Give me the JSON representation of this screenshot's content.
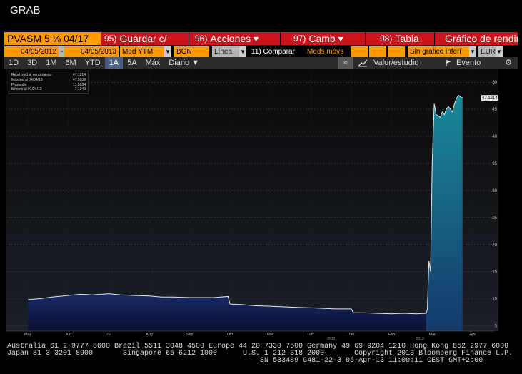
{
  "window": {
    "title": "GRAB"
  },
  "toolbar1": {
    "ticker": "PVASM 5 ⅛ 04/17",
    "buttons": [
      {
        "num": "95)",
        "label": "Guardar c/"
      },
      {
        "num": "96)",
        "label": "Acciones ▾"
      },
      {
        "num": "97)",
        "label": "Camb ▾"
      },
      {
        "num": "98)",
        "label": "Tabla"
      }
    ],
    "chart_title": "Gráfico de rendimiento"
  },
  "toolbar2": {
    "start_date": "04/05/2012",
    "dash": "-",
    "end_date": "04/05/2013",
    "field": "Med YTM",
    "source": "BGN",
    "chart_style": "Línea",
    "compare": "11) Comparar",
    "moving_avg": "Meds móvs",
    "event": "Sin gráfico inferi",
    "currency": "EUR"
  },
  "toolbar3": {
    "periods": [
      "1D",
      "3D",
      "1M",
      "6M",
      "YTD",
      "1A",
      "5A",
      "Máx"
    ],
    "selected_period": "1A",
    "frequency": "Diario ▼",
    "back": "«",
    "value_study": "Valor/estudio",
    "event": "Evento",
    "settings_icon": "gear-icon"
  },
  "legend": {
    "rows": [
      {
        "label": "Rend med al vencimiento",
        "value": "47.1214"
      },
      {
        "label": "Máximo al 04/04/13",
        "value": "47.5839"
      },
      {
        "label": "Promedio",
        "value": "11.5634"
      },
      {
        "label": "Mínimo al 01/24/13",
        "value": "7.1340"
      }
    ]
  },
  "chart_data": {
    "type": "area",
    "ylim": [
      4,
      52
    ],
    "yticks": [
      5,
      10,
      15,
      20,
      25,
      30,
      35,
      40,
      45,
      50
    ],
    "xlabels": [
      "May",
      "Jun",
      "Jul",
      "Aug",
      "Sep",
      "Oct",
      "Nov",
      "Dec",
      "Jan",
      "Feb",
      "Mar",
      "Apr"
    ],
    "year_labels": [
      {
        "text": "2012",
        "month": 7.5
      },
      {
        "text": "2013",
        "month": 9.7
      }
    ],
    "last_value_label": "47.1214",
    "x": [
      0,
      0.3,
      0.6,
      1.0,
      1.3,
      1.6,
      2.0,
      2.3,
      2.6,
      3.0,
      3.3,
      3.6,
      4.0,
      4.3,
      4.6,
      4.95,
      5.0,
      5.3,
      5.6,
      6.0,
      6.3,
      6.6,
      7.0,
      7.3,
      7.6,
      8.0,
      8.05,
      8.3,
      8.6,
      9.0,
      9.3,
      9.6,
      9.85,
      9.88,
      9.92,
      9.96,
      10.0,
      10.05,
      10.1,
      10.15,
      10.2,
      10.25,
      10.3,
      10.35,
      10.4,
      10.45,
      10.5,
      10.55,
      10.6,
      10.65,
      10.7,
      10.75
    ],
    "y": [
      9.8,
      10.0,
      10.3,
      10.6,
      10.8,
      10.7,
      10.9,
      10.7,
      10.6,
      10.5,
      10.3,
      10.3,
      10.2,
      10.2,
      10.2,
      10.4,
      9.0,
      8.9,
      8.7,
      8.6,
      8.5,
      8.4,
      8.3,
      8.2,
      8.1,
      8.1,
      7.4,
      7.4,
      7.3,
      7.2,
      7.3,
      7.2,
      7.3,
      8.0,
      17.0,
      15.0,
      35.0,
      46.0,
      44.0,
      43.8,
      43.5,
      44.5,
      44.0,
      45.0,
      45.5,
      45.0,
      44.5,
      46.0,
      47.0,
      47.6,
      47.3,
      47.1
    ]
  },
  "footer": {
    "line1": "Australia 61 2 9777 8600 Brazil 5511 3048 4500 Europe 44 20 7330 7500 Germany 49 69 9204 1210 Hong Kong 852 2977 6000",
    "line2": "Japan 81 3 3201 8900       Singapore 65 6212 1000      U.S. 1 212 318 2000       Copyright 2013 Bloomberg Finance L.P.",
    "line3": "                                                           SN 533489 G481-22-3 05-Apr-13 11:00:11 CEST GMT+2:00"
  }
}
